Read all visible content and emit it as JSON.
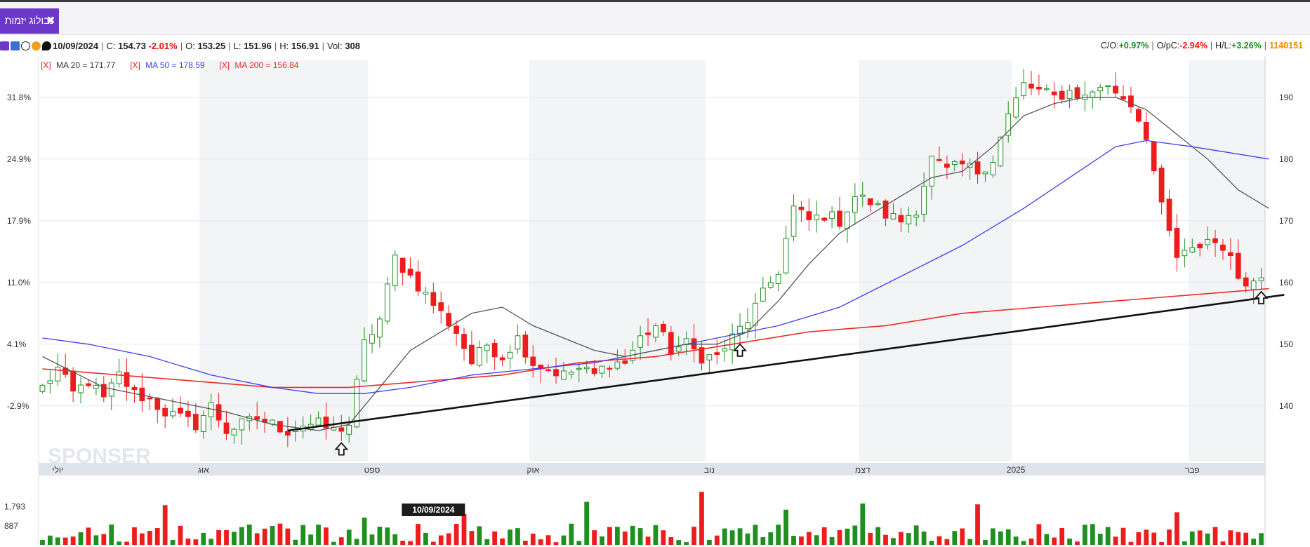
{
  "tab": {
    "label": "נבולוג יזמות",
    "close": "✖"
  },
  "info": {
    "date": "10/09/2024",
    "c_label": "C:",
    "c_val": "154.73",
    "c_pct": "-2.01%",
    "o_label": "O:",
    "o_val": "153.25",
    "l_label": "L:",
    "l_val": "151.96",
    "h_label": "H:",
    "h_val": "156.91",
    "vol_label": "Vol:",
    "vol_val": "308",
    "co_label": "C/O:",
    "co_val": "+0.97%",
    "opc_label": "O/pC:",
    "opc_val": "-2.94%",
    "hl_label": "H/L:",
    "hl_val": "+3.26%",
    "id": "1140151"
  },
  "colors": {
    "up": "#1f8f1f",
    "down": "#ee1c1c",
    "ma20": "#555555",
    "ma50": "#3d3df0",
    "ma200": "#ee2a2a",
    "accent": "#6b38c9"
  },
  "chart_data": {
    "type": "candlestick",
    "title": "",
    "legend": [
      {
        "mark": "[X]",
        "label": "MA 20 = 171.77",
        "color": "#333333"
      },
      {
        "mark": "[X]",
        "label": "MA 50 = 178.59",
        "color": "#3d3df0"
      },
      {
        "mark": "[X]",
        "label": "MA 200 = 156.84",
        "color": "#ee2a2a"
      }
    ],
    "ylim": [
      131,
      196
    ],
    "y_ticks_right": [
      140,
      150,
      160,
      170,
      180,
      190
    ],
    "y_ticks_left": [
      "-2.9%",
      "4.1%",
      "11.0%",
      "17.9%",
      "24.9%",
      "31.8%"
    ],
    "x_ticks": [
      {
        "label": "יולי",
        "i": 2
      },
      {
        "label": "אוג",
        "i": 21
      },
      {
        "label": "ספט",
        "i": 43
      },
      {
        "label": "אוק",
        "i": 64
      },
      {
        "label": "נוב",
        "i": 87
      },
      {
        "label": "דצמ",
        "i": 107
      },
      {
        "label": "2025",
        "i": 127
      },
      {
        "label": "פבר",
        "i": 150
      }
    ],
    "volume_ticks": [
      "1,793",
      "887"
    ],
    "volume_max": 3200,
    "cursor_label": "10/09/2024",
    "cursor_i": 51,
    "trendline": {
      "from": [
        32,
        136
      ],
      "to": [
        162,
        158
      ]
    },
    "arrows_at": [
      39,
      91,
      159
    ],
    "seed": {
      "start": 142,
      "n": 160
    },
    "waypoints": [
      [
        0,
        143
      ],
      [
        2,
        146
      ],
      [
        4,
        142
      ],
      [
        6,
        144
      ],
      [
        8,
        141
      ],
      [
        10,
        145
      ],
      [
        12,
        142
      ],
      [
        14,
        141
      ],
      [
        16,
        139
      ],
      [
        18,
        138
      ],
      [
        20,
        137
      ],
      [
        22,
        140
      ],
      [
        24,
        136
      ],
      [
        26,
        137
      ],
      [
        28,
        138
      ],
      [
        30,
        137
      ],
      [
        32,
        136
      ],
      [
        34,
        137
      ],
      [
        36,
        137
      ],
      [
        38,
        136
      ],
      [
        40,
        137
      ],
      [
        42,
        150
      ],
      [
        44,
        154
      ],
      [
        46,
        164
      ],
      [
        48,
        161
      ],
      [
        50,
        158
      ],
      [
        52,
        155
      ],
      [
        54,
        152
      ],
      [
        56,
        147
      ],
      [
        58,
        150
      ],
      [
        60,
        148
      ],
      [
        62,
        151
      ],
      [
        64,
        147
      ],
      [
        66,
        146
      ],
      [
        68,
        145
      ],
      [
        70,
        146
      ],
      [
        72,
        145
      ],
      [
        74,
        147
      ],
      [
        76,
        147
      ],
      [
        78,
        151
      ],
      [
        80,
        153
      ],
      [
        82,
        149
      ],
      [
        84,
        150
      ],
      [
        86,
        148
      ],
      [
        88,
        148
      ],
      [
        90,
        151
      ],
      [
        92,
        154
      ],
      [
        94,
        158
      ],
      [
        96,
        162
      ],
      [
        98,
        172
      ],
      [
        100,
        170
      ],
      [
        102,
        171
      ],
      [
        104,
        170
      ],
      [
        106,
        174
      ],
      [
        108,
        173
      ],
      [
        110,
        171
      ],
      [
        112,
        170
      ],
      [
        114,
        172
      ],
      [
        116,
        180
      ],
      [
        118,
        178
      ],
      [
        120,
        179
      ],
      [
        122,
        178
      ],
      [
        124,
        180
      ],
      [
        126,
        187
      ],
      [
        128,
        192
      ],
      [
        130,
        191
      ],
      [
        132,
        190
      ],
      [
        134,
        191
      ],
      [
        136,
        190
      ],
      [
        138,
        192
      ],
      [
        140,
        191
      ],
      [
        142,
        189
      ],
      [
        144,
        184
      ],
      [
        146,
        172
      ],
      [
        148,
        164
      ],
      [
        150,
        165
      ],
      [
        152,
        167
      ],
      [
        154,
        166
      ],
      [
        156,
        161
      ],
      [
        158,
        160
      ],
      [
        159,
        161
      ]
    ],
    "ma20": [
      [
        0,
        148
      ],
      [
        8,
        143
      ],
      [
        16,
        141
      ],
      [
        24,
        139
      ],
      [
        30,
        137
      ],
      [
        36,
        136
      ],
      [
        40,
        137
      ],
      [
        44,
        143
      ],
      [
        48,
        149
      ],
      [
        52,
        152
      ],
      [
        56,
        155
      ],
      [
        60,
        156
      ],
      [
        64,
        153
      ],
      [
        68,
        151
      ],
      [
        72,
        149
      ],
      [
        76,
        148
      ],
      [
        80,
        149
      ],
      [
        84,
        150
      ],
      [
        88,
        150
      ],
      [
        92,
        152
      ],
      [
        96,
        157
      ],
      [
        100,
        163
      ],
      [
        104,
        168
      ],
      [
        108,
        171
      ],
      [
        112,
        174
      ],
      [
        116,
        177
      ],
      [
        120,
        178
      ],
      [
        124,
        182
      ],
      [
        128,
        187
      ],
      [
        132,
        189
      ],
      [
        136,
        190
      ],
      [
        140,
        190
      ],
      [
        144,
        188
      ],
      [
        148,
        184
      ],
      [
        152,
        180
      ],
      [
        156,
        175
      ],
      [
        160,
        172
      ]
    ],
    "ma50": [
      [
        0,
        151
      ],
      [
        6,
        150
      ],
      [
        14,
        148
      ],
      [
        22,
        145
      ],
      [
        30,
        143
      ],
      [
        36,
        142
      ],
      [
        42,
        142
      ],
      [
        48,
        143
      ],
      [
        56,
        145
      ],
      [
        64,
        146
      ],
      [
        72,
        147
      ],
      [
        80,
        149
      ],
      [
        88,
        151
      ],
      [
        96,
        153
      ],
      [
        104,
        156
      ],
      [
        112,
        161
      ],
      [
        120,
        166
      ],
      [
        128,
        172
      ],
      [
        134,
        177
      ],
      [
        140,
        182
      ],
      [
        144,
        183
      ],
      [
        150,
        182
      ],
      [
        160,
        180
      ]
    ],
    "ma200": [
      [
        0,
        146
      ],
      [
        10,
        145
      ],
      [
        20,
        144
      ],
      [
        30,
        143
      ],
      [
        40,
        143
      ],
      [
        50,
        144
      ],
      [
        60,
        145
      ],
      [
        70,
        147
      ],
      [
        80,
        148
      ],
      [
        90,
        150
      ],
      [
        100,
        152
      ],
      [
        110,
        153
      ],
      [
        120,
        155
      ],
      [
        130,
        156
      ],
      [
        140,
        157
      ],
      [
        150,
        158
      ],
      [
        160,
        159
      ]
    ]
  }
}
